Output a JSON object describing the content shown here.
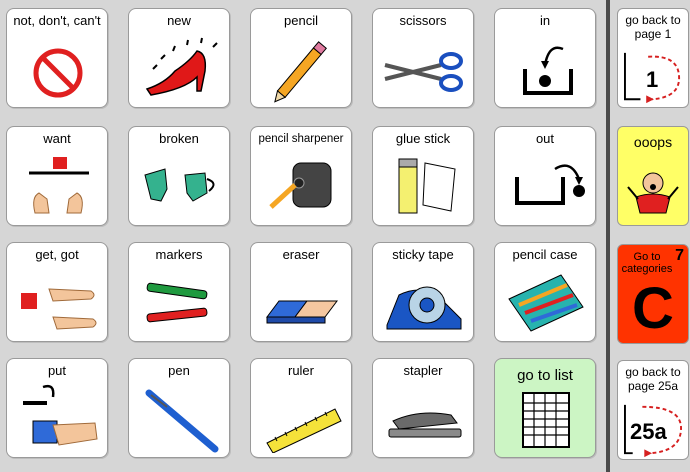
{
  "grid": {
    "r0": [
      "not, don't, can't",
      "new",
      "pencil",
      "scissors",
      "in"
    ],
    "r1": [
      "want",
      "broken",
      "pencil sharpener",
      "glue stick",
      "out"
    ],
    "r2": [
      "get, got",
      "markers",
      "eraser",
      "sticky tape",
      "pencil case"
    ],
    "r3": [
      "put",
      "pen",
      "ruler",
      "stapler",
      "go to list"
    ]
  },
  "side": {
    "back1": "go back to page 1",
    "back1_num": "1",
    "ooops": "ooops",
    "categories": "Go to categories",
    "categories_num": "7",
    "categories_letter": "C",
    "back25": "go back to page 25a",
    "back25_num": "25a"
  },
  "colors": {
    "go_list_bg": "#ccf5c4",
    "ooops_bg": "#ffff66",
    "categories_bg": "#ff3300",
    "accent_red": "#d62020"
  }
}
